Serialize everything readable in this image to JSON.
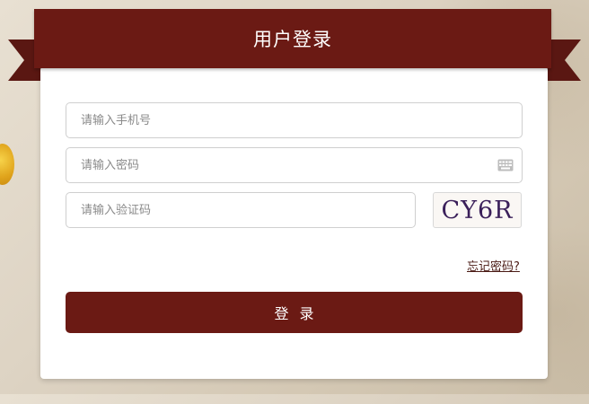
{
  "header": {
    "title": "用户登录"
  },
  "form": {
    "phone_placeholder": "请输入手机号",
    "password_placeholder": "请输入密码",
    "code_placeholder": "请输入验证码",
    "captcha_text": "CY6R",
    "forgot_label": "忘记密码?",
    "submit_label": "登录"
  },
  "icons": {
    "password_field": "keyboard-icon"
  },
  "colors": {
    "brand": "#6b1a14",
    "ribbon_dark": "#5a1712"
  }
}
